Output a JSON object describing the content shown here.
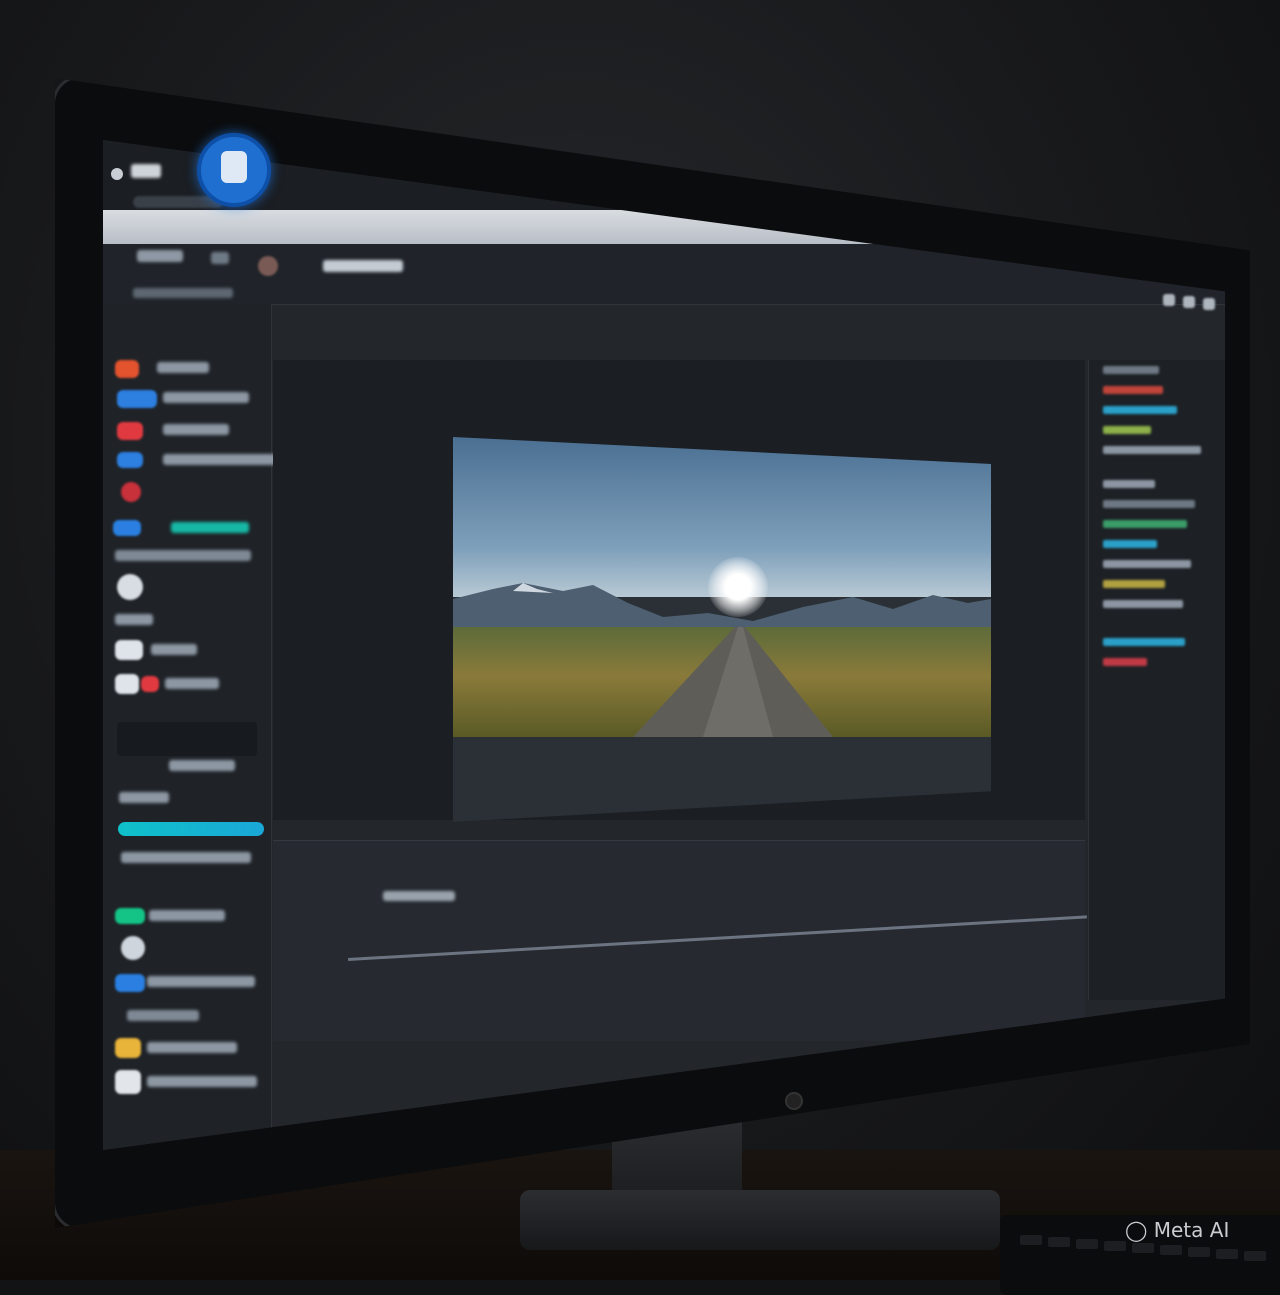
{
  "watermark": "Meta AI",
  "colors": {
    "accent": "#0fc1c9",
    "app_logo": "#1f6fd1",
    "panel": "#23272c",
    "sidebar": "#1f2328"
  },
  "icons": {
    "app_logo": "app-logo-icon",
    "minimize": "minimize-icon",
    "maximize": "maximize-icon",
    "close": "close-icon"
  }
}
